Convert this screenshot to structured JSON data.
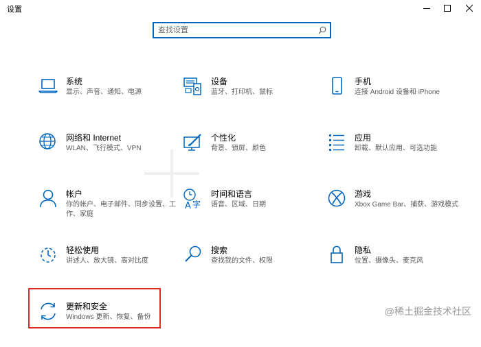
{
  "window": {
    "title": "设置"
  },
  "search": {
    "placeholder": "查找设置"
  },
  "tiles": [
    {
      "title": "系统",
      "desc": "显示、声音、通知、电源",
      "icon": "laptop-icon"
    },
    {
      "title": "设备",
      "desc": "蓝牙、打印机、鼠标",
      "icon": "devices-icon"
    },
    {
      "title": "手机",
      "desc": "连接 Android 设备和 iPhone",
      "icon": "phone-icon"
    },
    {
      "title": "网络和 Internet",
      "desc": "WLAN、飞行模式、VPN",
      "icon": "globe-icon"
    },
    {
      "title": "个性化",
      "desc": "背景、锁屏、颜色",
      "icon": "personalization-icon"
    },
    {
      "title": "应用",
      "desc": "卸载、默认应用、可选功能",
      "icon": "apps-list-icon"
    },
    {
      "title": "帐户",
      "desc": "你的帐户、电子邮件、同步设置、工作、家庭",
      "icon": "person-icon"
    },
    {
      "title": "时间和语言",
      "desc": "语音、区域、日期",
      "icon": "time-language-icon"
    },
    {
      "title": "游戏",
      "desc": "Xbox Game Bar、捕获、游戏模式",
      "icon": "xbox-icon"
    },
    {
      "title": "轻松使用",
      "desc": "讲述人、放大镜、高对比度",
      "icon": "ease-of-access-icon"
    },
    {
      "title": "搜索",
      "desc": "查找我的文件、权限",
      "icon": "search-magnifier-icon"
    },
    {
      "title": "隐私",
      "desc": "位置、摄像头、麦克风",
      "icon": "lock-icon"
    },
    {
      "title": "更新和安全",
      "desc": "Windows 更新、恢复、备份",
      "icon": "update-sync-icon"
    }
  ],
  "watermark": "@稀土掘金技术社区",
  "colors": {
    "accent": "#0067c0",
    "highlight": "#e02a2a"
  }
}
